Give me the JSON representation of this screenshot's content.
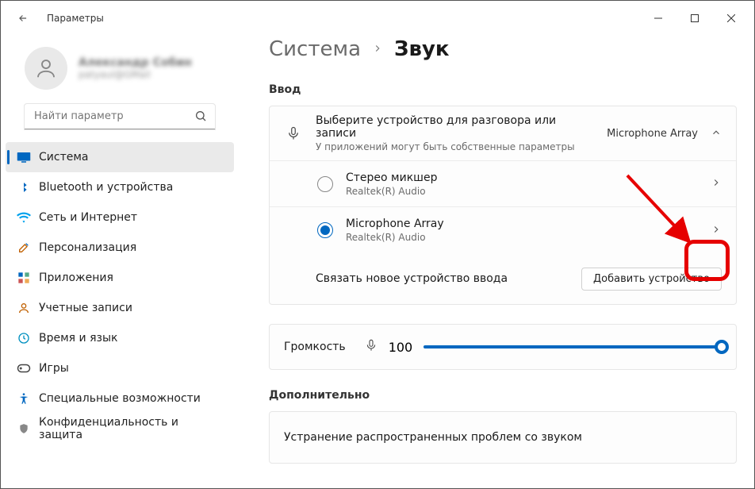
{
  "window": {
    "title": "Параметры"
  },
  "user": {
    "name": "Александр Собин",
    "email": "patyaul@GMail"
  },
  "search": {
    "placeholder": "Найти параметр"
  },
  "nav": [
    {
      "label": "Система",
      "icon": "display",
      "active": true
    },
    {
      "label": "Bluetooth и устройства",
      "icon": "bluetooth"
    },
    {
      "label": "Сеть и Интернет",
      "icon": "wifi"
    },
    {
      "label": "Персонализация",
      "icon": "brush"
    },
    {
      "label": "Приложения",
      "icon": "apps"
    },
    {
      "label": "Учетные записи",
      "icon": "user"
    },
    {
      "label": "Время и язык",
      "icon": "clock"
    },
    {
      "label": "Игры",
      "icon": "game"
    },
    {
      "label": "Специальные возможности",
      "icon": "accessibility"
    },
    {
      "label": "Конфиденциальность и защита",
      "icon": "shield"
    }
  ],
  "breadcrumb": {
    "parent": "Система",
    "current": "Звук"
  },
  "sections": {
    "input_label": "Ввод",
    "advanced_label": "Дополнительно"
  },
  "input_header": {
    "title": "Выберите устройство для разговора или записи",
    "subtitle": "У приложений могут быть собственные параметры",
    "value": "Microphone Array"
  },
  "devices": [
    {
      "name": "Стерео микшер",
      "sub": "Realtek(R) Audio",
      "selected": false
    },
    {
      "name": "Microphone Array",
      "sub": "Realtek(R) Audio",
      "selected": true
    }
  ],
  "pair_row": {
    "title": "Связать новое устройство ввода",
    "button": "Добавить устройство"
  },
  "volume": {
    "label": "Громкость",
    "value": "100"
  },
  "troubleshoot": {
    "title": "Устранение распространенных проблем со звуком"
  }
}
